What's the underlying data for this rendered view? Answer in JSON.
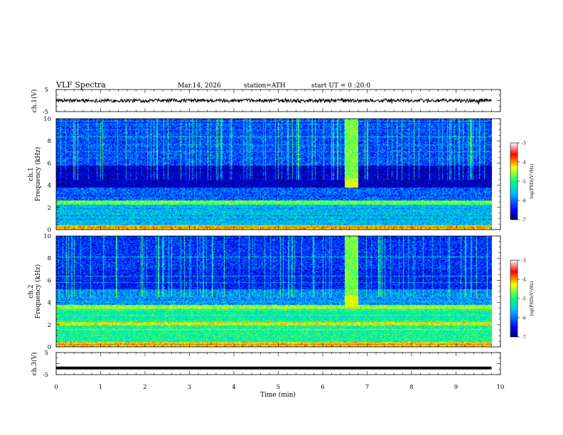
{
  "header": {
    "title": "VLF  Spectra",
    "date": "Mar.14, 2026",
    "station": "station=ATH",
    "start_ut": "start  UT  =    0  :20:0"
  },
  "chart_data": [
    {
      "type": "line",
      "name": "ch1-waveform",
      "ylabel": "ch.1(V)",
      "yticks": [
        "5",
        "-5"
      ],
      "ylim": [
        -5,
        5
      ],
      "xlim": [
        0,
        10
      ],
      "baseline": 0,
      "amplitude": 0.8
    },
    {
      "type": "heatmap",
      "name": "ch1-spectrogram",
      "ylabel": [
        "ch.1",
        "Frequency  (kHz)"
      ],
      "yticks": [
        "0",
        "2",
        "4",
        "6",
        "8",
        "10"
      ],
      "ylim": [
        0,
        10
      ],
      "xlim": [
        0,
        9.8
      ],
      "xlabel": "Time  (min)",
      "colorbar": {
        "label": "log(PSD)(V²/Hz)",
        "ticks": [
          "-3",
          "-4",
          "-5",
          "-6",
          "-7"
        ],
        "range": [
          -7,
          -3
        ],
        "colors": [
          "#000060",
          "#0000ff",
          "#00c0ff",
          "#00ff80",
          "#ffff00",
          "#ff0000",
          "#ffffff"
        ]
      },
      "features": {
        "burst_time_min": [
          6.5,
          6.8
        ],
        "burst_freq_khz": [
          3.8,
          4.6
        ],
        "quiet_band_khz": [
          3.8,
          5.8
        ]
      }
    },
    {
      "type": "heatmap",
      "name": "ch2-spectrogram",
      "ylabel": [
        "ch.2",
        "Frequency  (kHz)"
      ],
      "yticks": [
        "0",
        "2",
        "4",
        "6",
        "8",
        "10"
      ],
      "ylim": [
        0,
        10
      ],
      "xlim": [
        0,
        9.8
      ],
      "xlabel": "Time  (min)",
      "colorbar": {
        "label": "log(PSD)(V²/Hz)",
        "ticks": [
          "-3",
          "-4",
          "-5",
          "-6",
          "-7"
        ],
        "range": [
          -7,
          -3
        ],
        "colors": [
          "#000060",
          "#0000ff",
          "#00c0ff",
          "#00ff80",
          "#ffff00",
          "#ff0000",
          "#ffffff"
        ]
      },
      "features": {
        "burst_time_min": [
          6.5,
          6.8
        ],
        "burst_freq_khz": [
          3.6,
          4.6
        ],
        "quiet_band_khz": [
          5.2,
          7.0
        ]
      }
    },
    {
      "type": "line",
      "name": "ch3-waveform",
      "ylabel": "ch.3(V)",
      "yticks": [
        "5",
        "0",
        "-5"
      ],
      "ylim": [
        -5,
        5
      ],
      "xlim": [
        0,
        10
      ],
      "constant_value": -2
    }
  ],
  "xaxis": {
    "label": "Time  (min)",
    "ticks": [
      "0",
      "1",
      "2",
      "3",
      "4",
      "5",
      "6",
      "7",
      "8",
      "9",
      "10"
    ]
  }
}
